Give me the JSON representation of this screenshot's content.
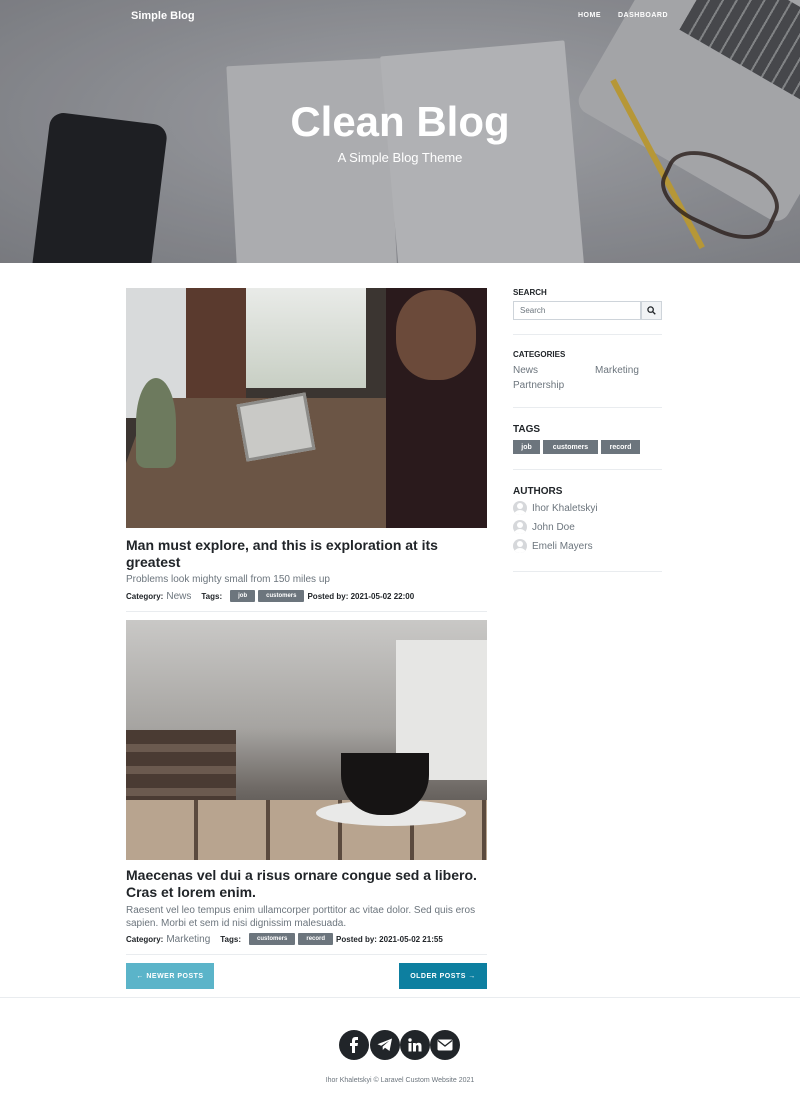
{
  "nav": {
    "brand": "Simple Blog",
    "links": [
      "Home",
      "Dashboard"
    ]
  },
  "hero": {
    "title": "Clean Blog",
    "subtitle": "A Simple Blog Theme"
  },
  "posts": [
    {
      "title": "Man must explore, and this is exploration at its greatest",
      "subtitle": "Problems look mighty small from 150 miles up",
      "category_label": "Category:",
      "category": "News",
      "tags_label": "Tags:",
      "tags": [
        "job",
        "customers"
      ],
      "posted_label": "Posted by: 2021-05-02 22:00"
    },
    {
      "title": "Maecenas vel dui a risus ornare congue sed a libero. Cras et lorem enim.",
      "subtitle": "Raesent vel leo tempus enim ullamcorper porttitor ac vitae dolor. Sed quis eros sapien. Morbi et sem id nisi dignissim malesuada.",
      "category_label": "Category:",
      "category": "Marketing",
      "tags_label": "Tags:",
      "tags": [
        "customers",
        "record"
      ],
      "posted_label": "Posted by: 2021-05-02 21:55"
    }
  ],
  "pager": {
    "newer": "← Newer Posts",
    "older": "Older Posts →"
  },
  "sidebar": {
    "search_title": "Search",
    "search_placeholder": "Search",
    "categories_title": "Categories",
    "categories": [
      "News",
      "Marketing",
      "Partnership"
    ],
    "tags_title": "Tags",
    "tags": [
      "job",
      "customers",
      "record"
    ],
    "authors_title": "Authors",
    "authors": [
      "Ihor Khaletskyi",
      "John Doe",
      "Emeli Mayers"
    ]
  },
  "footer": {
    "social_icons": [
      "facebook-icon",
      "telegram-icon",
      "linkedin-icon",
      "mail-icon"
    ],
    "copyright": "Ihor Khaletskyi © Laravel Custom Website 2021"
  }
}
